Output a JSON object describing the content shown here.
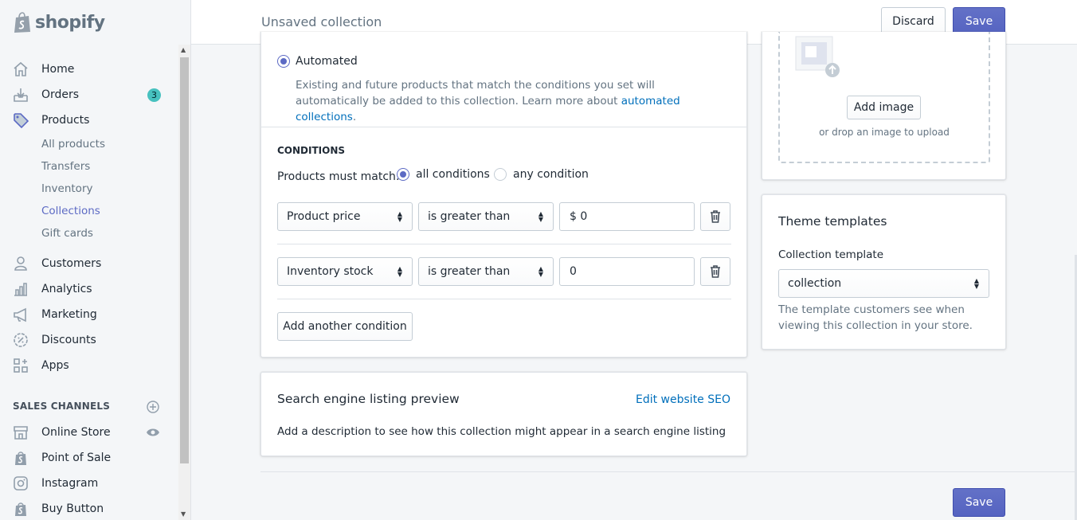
{
  "brand": {
    "name": "shopify"
  },
  "sidebar": {
    "nav": [
      {
        "label": "Home",
        "icon": "home-icon"
      },
      {
        "label": "Orders",
        "icon": "orders-icon",
        "badge": "3"
      },
      {
        "label": "Products",
        "icon": "tag-icon"
      }
    ],
    "products_sub": [
      "All products",
      "Transfers",
      "Inventory",
      "Collections",
      "Gift cards"
    ],
    "nav2": [
      {
        "label": "Customers",
        "icon": "person-icon"
      },
      {
        "label": "Analytics",
        "icon": "bar-chart-icon"
      },
      {
        "label": "Marketing",
        "icon": "megaphone-icon"
      },
      {
        "label": "Discounts",
        "icon": "discount-icon"
      },
      {
        "label": "Apps",
        "icon": "apps-icon"
      }
    ],
    "sales_channels_heading": "SALES CHANNELS",
    "channels": [
      {
        "label": "Online Store",
        "icon": "store-icon"
      },
      {
        "label": "Point of Sale",
        "icon": "shopify-bag-icon"
      },
      {
        "label": "Instagram",
        "icon": "instagram-icon"
      },
      {
        "label": "Buy Button",
        "icon": "shopify-bag-icon"
      }
    ]
  },
  "topbar": {
    "title": "Unsaved collection",
    "discard_label": "Discard",
    "save_label": "Save"
  },
  "collection_type": {
    "automated_label": "Automated",
    "description_prefix": "Existing and future products that match the conditions you set will automatically be added to this collection. Learn more about ",
    "description_link": "automated collections",
    "description_suffix": "."
  },
  "conditions": {
    "heading": "CONDITIONS",
    "match_label": "Products must match:",
    "all_label": "all conditions",
    "any_label": "any condition",
    "rows": [
      {
        "field": "Product price",
        "operator": "is greater than",
        "value": "$ 0"
      },
      {
        "field": "Inventory stock",
        "operator": "is greater than",
        "value": "0"
      }
    ],
    "add_label": "Add another condition"
  },
  "seo": {
    "title": "Search engine listing preview",
    "edit_link": "Edit website SEO",
    "description": "Add a description to see how this collection might appear in a search engine listing"
  },
  "image_card": {
    "add_label": "Add image",
    "drop_text": "or drop an image to upload"
  },
  "theme": {
    "title": "Theme templates",
    "template_label": "Collection template",
    "template_value": "collection",
    "help": "The template customers see when viewing this collection in your store."
  },
  "footer": {
    "save_label": "Save"
  }
}
